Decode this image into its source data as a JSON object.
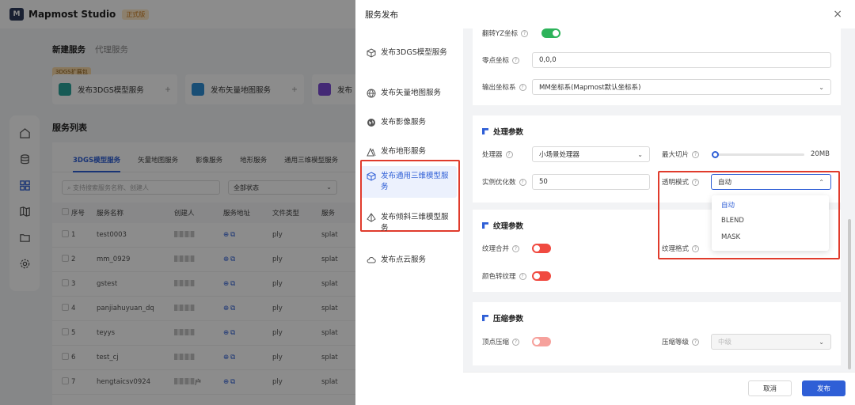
{
  "app": {
    "title": "Mapmost Studio",
    "edition_badge": "正式版",
    "logo_glyph": "M"
  },
  "background": {
    "top_tabs": [
      "新建服务",
      "代理服务"
    ],
    "ext_badge": "3DGS扩展包",
    "service_cards": [
      "发布3DGS模型服务",
      "发布矢量地图服务",
      "发布"
    ],
    "list_title": "服务列表",
    "list_tabs": [
      "3DGS模型服务",
      "矢量地图服务",
      "影像服务",
      "地形服务",
      "通用三维模型服务"
    ],
    "search_placeholder": "支持搜索服务名称、创建人",
    "status_select": "全部状态",
    "columns": [
      "序号",
      "服务名称",
      "创建人",
      "服务地址",
      "文件类型",
      "服务"
    ],
    "rows": [
      {
        "no": "1",
        "name": "test0003",
        "type": "ply",
        "svc": "splat"
      },
      {
        "no": "2",
        "name": "mm_0929",
        "type": "ply",
        "svc": "splat"
      },
      {
        "no": "3",
        "name": "gstest",
        "type": "ply",
        "svc": "splat"
      },
      {
        "no": "4",
        "name": "panjiahuyuan_dq",
        "type": "ply",
        "svc": "splat"
      },
      {
        "no": "5",
        "name": "teyys",
        "type": "ply",
        "svc": "splat"
      },
      {
        "no": "6",
        "name": "test_cj",
        "type": "ply",
        "svc": "splat"
      },
      {
        "no": "7",
        "name": "hengtaicsv0924",
        "type": "ply",
        "svc": "splat",
        "creator_suffix": "户"
      }
    ]
  },
  "drawer": {
    "title": "服务发布",
    "close": "×",
    "nav": [
      {
        "label": "发布3DGS模型服务",
        "icon": "cube-outline-icon"
      },
      {
        "label": "发布矢量地图服务",
        "icon": "globe-icon"
      },
      {
        "label": "发布影像服务",
        "icon": "image-globe-icon"
      },
      {
        "label": "发布地形服务",
        "icon": "mountain-icon"
      },
      {
        "label": "发布通用三维模型服务",
        "icon": "3d-box-icon",
        "active": true
      },
      {
        "label": "发布倾斜三维模型服务",
        "icon": "tilt-pyramid-icon"
      },
      {
        "label": "发布点云服务",
        "icon": "cloud-icon"
      }
    ],
    "basic": {
      "flip_yz_label": "翻转YZ坐标",
      "flip_yz_on": true,
      "origin_label": "零点坐标",
      "origin_value": "0,0,0",
      "crs_label": "输出坐标系",
      "crs_value": "MM坐标系(Mapmost默认坐标系)"
    },
    "processing": {
      "title": "处理参数",
      "processor_label": "处理器",
      "processor_value": "小场景处理器",
      "max_tile_label": "最大切片",
      "max_tile_value": "20MB",
      "max_tile_level": 0.03,
      "instance_label": "实例优化数",
      "instance_value": "50",
      "transparent_label": "透明模式",
      "transparent_value": "自动",
      "transparent_options": [
        "自动",
        "BLEND",
        "MASK"
      ]
    },
    "texture": {
      "title": "纹理参数",
      "merge_label": "纹理合并",
      "merge_on": false,
      "format_label": "纹理格式",
      "color_label": "颜色转纹理",
      "color_on": false
    },
    "compress": {
      "title": "压缩参数",
      "vertex_label": "顶点压缩",
      "vertex_on": false,
      "level_label": "压缩等级",
      "level_value": "中级"
    },
    "footer": {
      "cancel": "取消",
      "publish": "发布"
    }
  },
  "colors": {
    "primary": "#2f5fd6",
    "toggle_on": "#2db35a",
    "toggle_off": "#f04a40",
    "highlight": "#e03b2c"
  }
}
